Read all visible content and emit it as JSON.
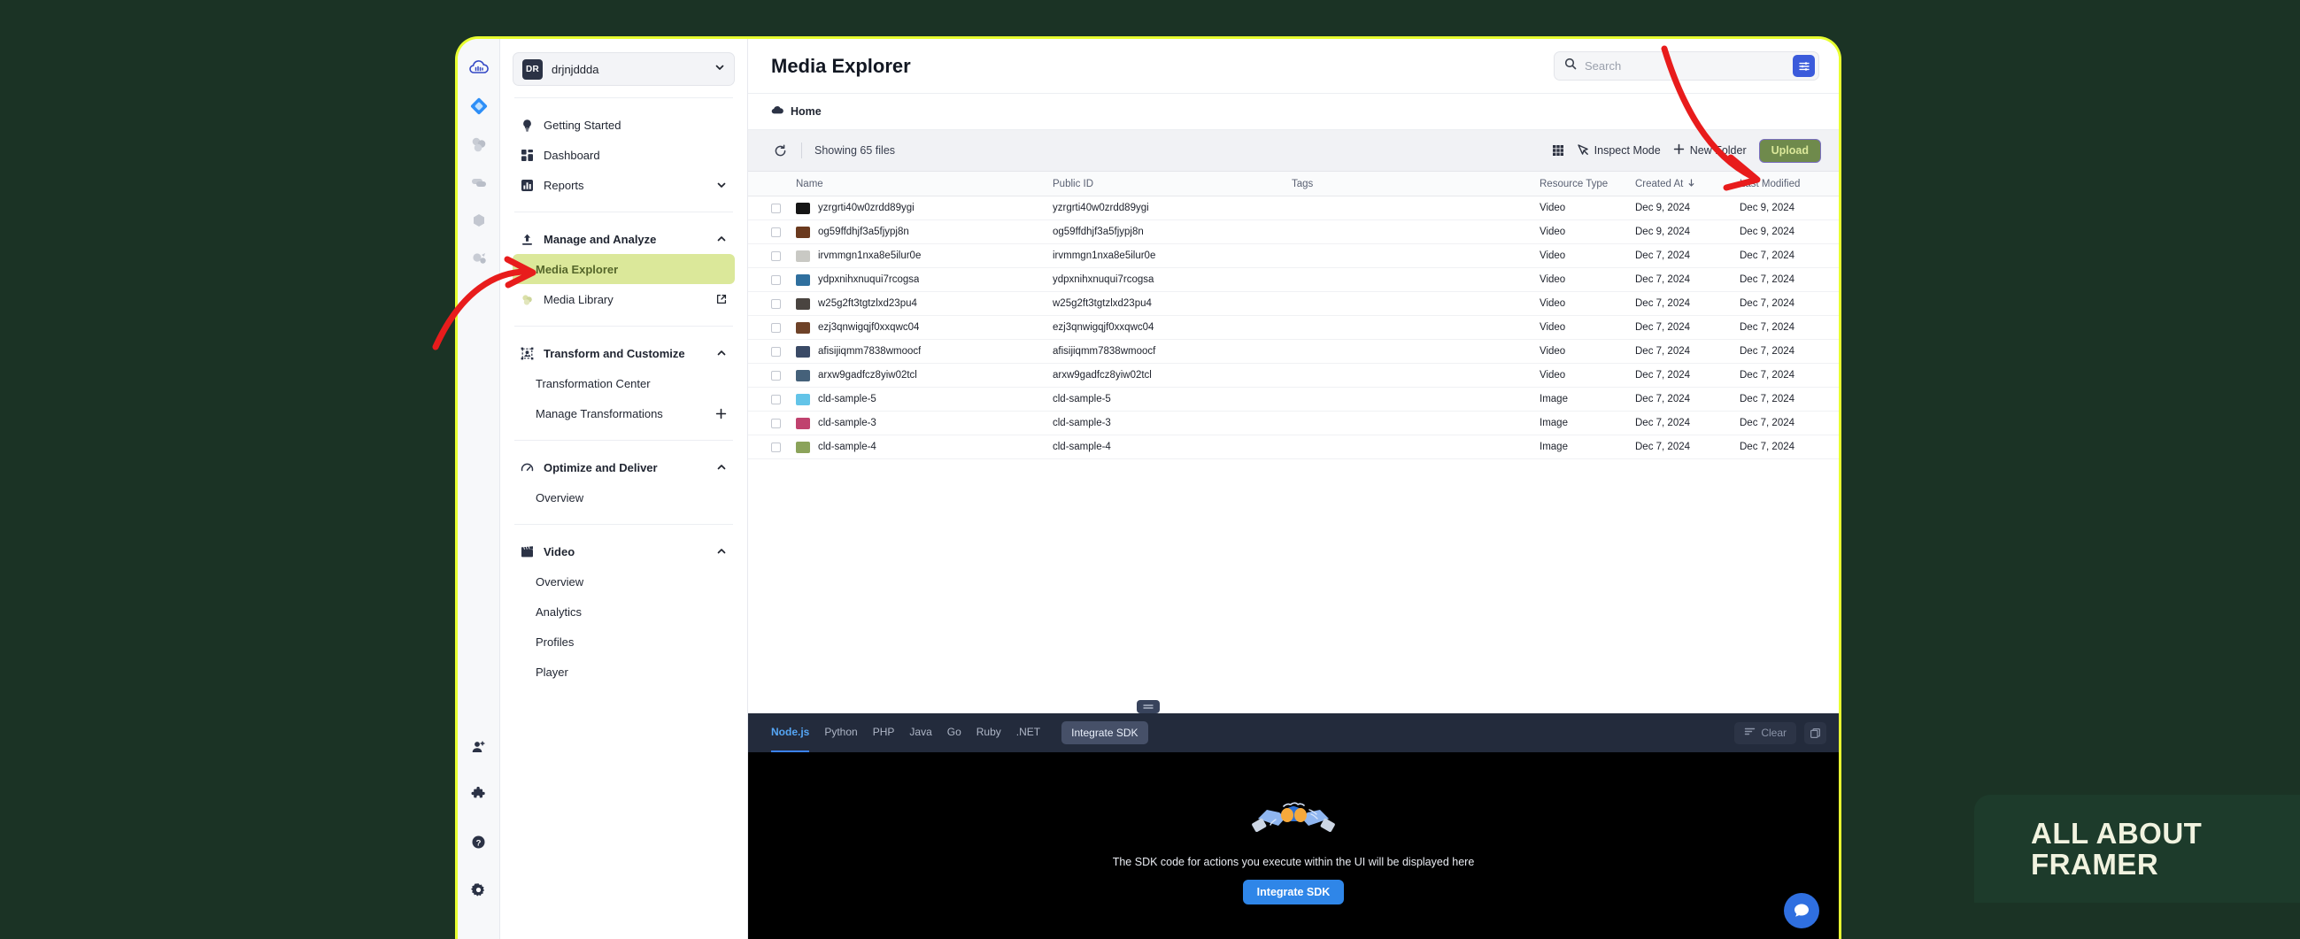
{
  "colors": {
    "page_background": "#1b3325",
    "frame_border": "#e8ff30",
    "accent_blue": "#3b5bdb",
    "active_nav_bg": "#dbe89a",
    "upload_highlight": "#6f8a4c",
    "annotation_red": "#e81c1c",
    "watermark_bg": "#1d3b2b"
  },
  "icon_rail": {
    "items": [
      {
        "name": "cloudinary-logo-icon"
      },
      {
        "name": "programmable-media-icon"
      },
      {
        "name": "assets-icon"
      },
      {
        "name": "media-optimizer-icon"
      },
      {
        "name": "cloud-shapes-icon"
      },
      {
        "name": "media-flows-icon"
      }
    ],
    "bottom_items": [
      {
        "name": "add-user-icon"
      },
      {
        "name": "extensions-icon"
      },
      {
        "name": "help-icon"
      },
      {
        "name": "settings-gear-icon"
      }
    ]
  },
  "sidebar": {
    "account": {
      "initials": "DR",
      "name": "drjnjddda",
      "chevron": "chevron-down-icon"
    },
    "groups": [
      {
        "items": [
          {
            "label": "Getting Started",
            "icon": "lightbulb-icon",
            "level": "top",
            "right": "",
            "active": false
          },
          {
            "label": "Dashboard",
            "icon": "dashboard-icon",
            "level": "top",
            "right": "",
            "active": false
          },
          {
            "label": "Reports",
            "icon": "reports-icon",
            "level": "top",
            "right": "chevron-down-icon",
            "active": false
          }
        ]
      },
      {
        "items": [
          {
            "label": "Manage and Analyze",
            "icon": "upload-arrow-icon",
            "level": "section",
            "right": "chevron-up-icon",
            "active": false
          },
          {
            "label": "Media Explorer",
            "icon": "",
            "level": "child",
            "right": "",
            "active": true
          },
          {
            "label": "Media Library",
            "icon": "media-library-icon",
            "level": "top",
            "right": "external-link-icon",
            "active": false
          }
        ]
      },
      {
        "items": [
          {
            "label": "Transform and Customize",
            "icon": "transform-icon",
            "level": "section",
            "right": "chevron-up-icon",
            "active": false
          },
          {
            "label": "Transformation Center",
            "icon": "",
            "level": "child",
            "right": "",
            "active": false
          },
          {
            "label": "Manage Transformations",
            "icon": "",
            "level": "child",
            "right": "plus-icon",
            "active": false
          }
        ]
      },
      {
        "items": [
          {
            "label": "Optimize and Deliver",
            "icon": "gauge-icon",
            "level": "section",
            "right": "chevron-up-icon",
            "active": false
          },
          {
            "label": "Overview",
            "icon": "",
            "level": "child",
            "right": "",
            "active": false
          }
        ]
      },
      {
        "items": [
          {
            "label": "Video",
            "icon": "clapperboard-icon",
            "level": "section",
            "right": "chevron-up-icon",
            "active": false
          },
          {
            "label": "Overview",
            "icon": "",
            "level": "child",
            "right": "",
            "active": false
          },
          {
            "label": "Analytics",
            "icon": "",
            "level": "child",
            "right": "",
            "active": false
          },
          {
            "label": "Profiles",
            "icon": "",
            "level": "child",
            "right": "",
            "active": false
          },
          {
            "label": "Player",
            "icon": "",
            "level": "child",
            "right": "",
            "active": false
          }
        ]
      }
    ]
  },
  "header": {
    "title": "Media Explorer",
    "search": {
      "placeholder": "Search",
      "value": ""
    },
    "filter_button_icon": "filter-sliders-icon"
  },
  "breadcrumb": {
    "icon": "cloud-icon",
    "label": "Home"
  },
  "toolbar": {
    "refresh_icon": "refresh-icon",
    "file_count": "Showing 65 files",
    "grid_view_label": "",
    "inspect_mode_label": "Inspect Mode",
    "new_folder_label": "New Folder",
    "upload_label": "Upload"
  },
  "table": {
    "columns": [
      "Name",
      "Public ID",
      "Tags",
      "Resource Type",
      "Created At",
      "Last Modified"
    ],
    "sorted_column": "Created At",
    "sort_icon": "sort-desc-arrow-icon",
    "rows": [
      {
        "name": "yzrgrti40w0zrdd89ygi",
        "public_id": "yzrgrti40w0zrdd89ygi",
        "tags": "",
        "type": "Video",
        "created": "Dec 9, 2024",
        "modified": "Dec 9, 2024",
        "thumb": "#151515"
      },
      {
        "name": "og59ffdhjf3a5fjypj8n",
        "public_id": "og59ffdhjf3a5fjypj8n",
        "tags": "",
        "type": "Video",
        "created": "Dec 9, 2024",
        "modified": "Dec 9, 2024",
        "thumb": "#6b3a1e"
      },
      {
        "name": "irvmmgn1nxa8e5ilur0e",
        "public_id": "irvmmgn1nxa8e5ilur0e",
        "tags": "",
        "type": "Video",
        "created": "Dec 7, 2024",
        "modified": "Dec 7, 2024",
        "thumb": "#c9c9c4"
      },
      {
        "name": "ydpxnihxnuqui7rcogsa",
        "public_id": "ydpxnihxnuqui7rcogsa",
        "tags": "",
        "type": "Video",
        "created": "Dec 7, 2024",
        "modified": "Dec 7, 2024",
        "thumb": "#2f6f9e"
      },
      {
        "name": "w25g2ft3tgtzlxd23pu4",
        "public_id": "w25g2ft3tgtzlxd23pu4",
        "tags": "",
        "type": "Video",
        "created": "Dec 7, 2024",
        "modified": "Dec 7, 2024",
        "thumb": "#4a4440"
      },
      {
        "name": "ezj3qnwigqjf0xxqwc04",
        "public_id": "ezj3qnwigqjf0xxqwc04",
        "tags": "",
        "type": "Video",
        "created": "Dec 7, 2024",
        "modified": "Dec 7, 2024",
        "thumb": "#6e4228"
      },
      {
        "name": "afisijiqmm7838wmoocf",
        "public_id": "afisijiqmm7838wmoocf",
        "tags": "",
        "type": "Video",
        "created": "Dec 7, 2024",
        "modified": "Dec 7, 2024",
        "thumb": "#3a4a66"
      },
      {
        "name": "arxw9gadfcz8yiw02tcl",
        "public_id": "arxw9gadfcz8yiw02tcl",
        "tags": "",
        "type": "Video",
        "created": "Dec 7, 2024",
        "modified": "Dec 7, 2024",
        "thumb": "#45617a"
      },
      {
        "name": "cld-sample-5",
        "public_id": "cld-sample-5",
        "tags": "",
        "type": "Image",
        "created": "Dec 7, 2024",
        "modified": "Dec 7, 2024",
        "thumb": "#63c4e8"
      },
      {
        "name": "cld-sample-3",
        "public_id": "cld-sample-3",
        "tags": "",
        "type": "Image",
        "created": "Dec 7, 2024",
        "modified": "Dec 7, 2024",
        "thumb": "#c0426e"
      },
      {
        "name": "cld-sample-4",
        "public_id": "cld-sample-4",
        "tags": "",
        "type": "Image",
        "created": "Dec 7, 2024",
        "modified": "Dec 7, 2024",
        "thumb": "#8ba35a"
      }
    ]
  },
  "sdk_panel": {
    "tabs": [
      {
        "label": "Node.js",
        "active": true
      },
      {
        "label": "Python",
        "active": false
      },
      {
        "label": "PHP",
        "active": false
      },
      {
        "label": "Java",
        "active": false
      },
      {
        "label": "Go",
        "active": false
      },
      {
        "label": "Ruby",
        "active": false
      },
      {
        "label": ".NET",
        "active": false
      }
    ],
    "integrate_button": "Integrate SDK",
    "clear_button": "Clear",
    "copy_icon": "copy-icon",
    "empty_illustration": "handshake-icon",
    "empty_text": "The SDK code for actions you execute within the UI will be displayed here",
    "cta_button": "Integrate SDK"
  },
  "fab": {
    "icon": "chat-support-icon"
  },
  "watermark": {
    "line1": "ALL ABOUT",
    "line2": "FRAMER"
  }
}
